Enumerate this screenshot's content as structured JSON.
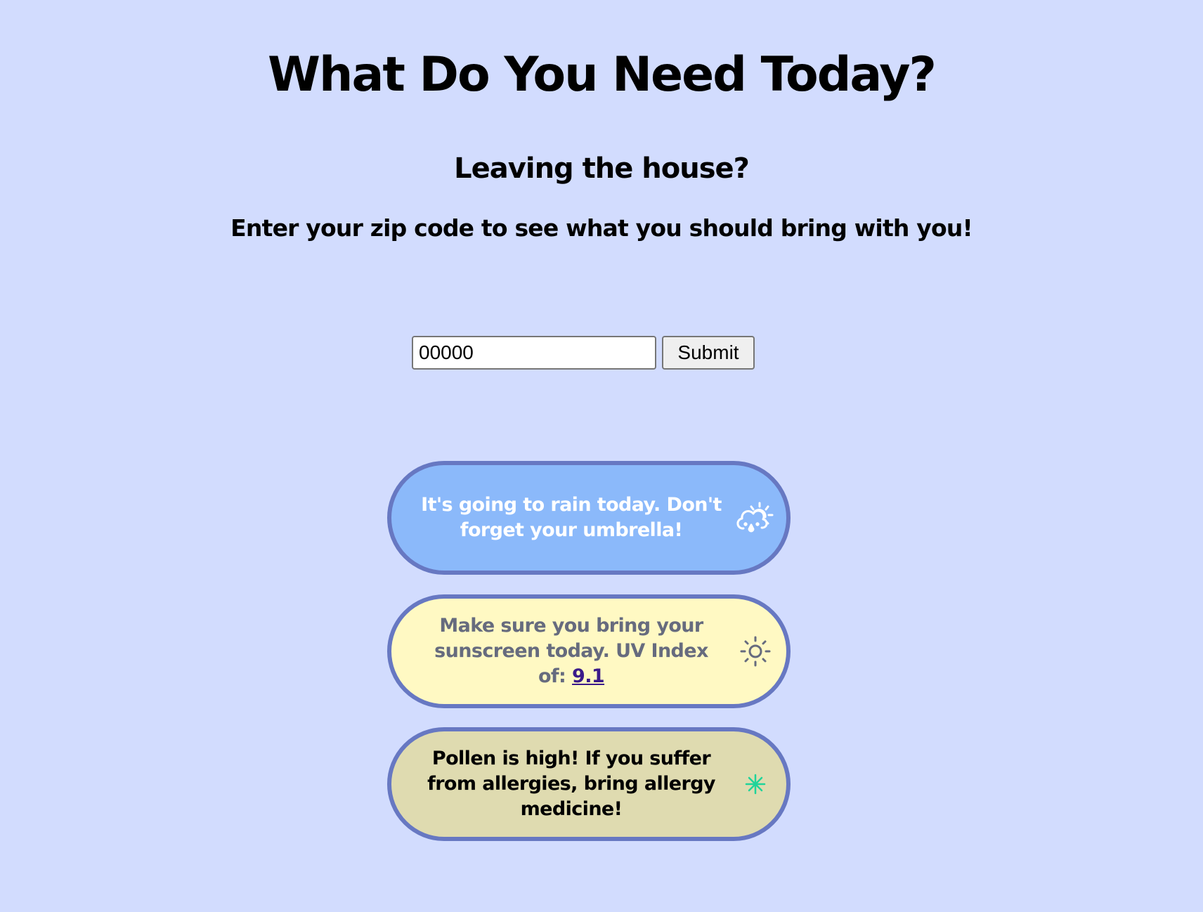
{
  "header": {
    "title": "What Do You Need Today?",
    "subtitle": "Leaving the house?",
    "instructions": "Enter your zip code to see what you should bring with you!"
  },
  "zip_form": {
    "input_value": "00000",
    "submit_label": "Submit"
  },
  "cards": {
    "rain": {
      "message": "It's going to rain today. Don't forget your umbrella!",
      "icon": "rain-cloud-sun-icon",
      "background": "#8bb9fa"
    },
    "sun": {
      "message": "Make sure you bring your sunscreen today. UV Index of:",
      "uv_value": "9.1",
      "icon": "sun-icon",
      "background": "#fff9c3"
    },
    "pollen": {
      "message": "Pollen is high! If you suffer from allergies, bring allergy medicine!",
      "icon": "pollen-asterisk-icon",
      "background": "#dfdbb0"
    }
  },
  "colors": {
    "page_background": "#d2dcfe",
    "card_border": "#6778c2",
    "pollen_icon": "#1ed49a",
    "uv_link": "#3b1b8a"
  }
}
